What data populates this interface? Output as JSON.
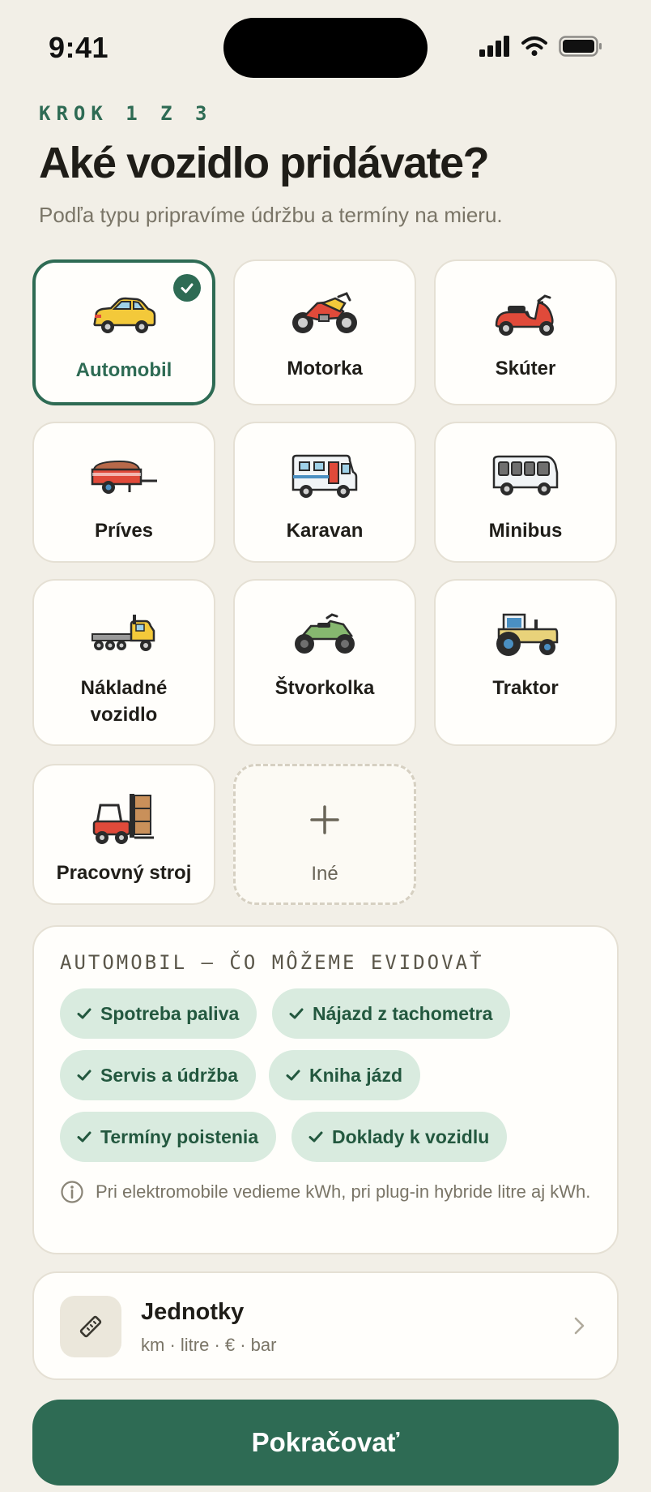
{
  "status_bar": {
    "time": "9:41"
  },
  "header": {
    "step": "KROK 1 Z 3",
    "title": "Aké vozidlo pridávate?",
    "subtitle": "Podľa typu pripravíme údržbu a termíny na mieru."
  },
  "vehicles": [
    {
      "label": "Automobil",
      "icon": "car-icon",
      "selected": true
    },
    {
      "label": "Motorka",
      "icon": "motorcycle-icon"
    },
    {
      "label": "Skúter",
      "icon": "scooter-icon"
    },
    {
      "label": "Príves",
      "icon": "trailer-icon"
    },
    {
      "label": "Karavan",
      "icon": "caravan-icon"
    },
    {
      "label": "Minibus",
      "icon": "minibus-icon"
    },
    {
      "label": "Nákladné vozidlo",
      "icon": "truck-icon"
    },
    {
      "label": "Štvorkolka",
      "icon": "quad-icon"
    },
    {
      "label": "Traktor",
      "icon": "tractor-icon"
    },
    {
      "label": "Pracovný stroj",
      "icon": "forklift-icon"
    },
    {
      "label": "Iné",
      "icon": "plus-icon"
    }
  ],
  "features": {
    "title": "AUTOMOBIL — ČO MÔŽEME EVIDOVAŤ",
    "chips": [
      "Spotreba paliva",
      "Nájazd z tachometra",
      "Servis a údržba",
      "Kniha jázd",
      "Termíny poistenia",
      "Doklady k vozidlu"
    ],
    "info": "Pri elektromobile vedieme kWh, pri plug-in hybride litre aj kWh."
  },
  "units": {
    "title": "Jednotky",
    "subtitle": "km · litre · € · bar"
  },
  "continue_label": "Pokračovať",
  "colors": {
    "accent": "#2e6b54",
    "background": "#f2efe7",
    "chip_bg": "#d9ebdf"
  }
}
